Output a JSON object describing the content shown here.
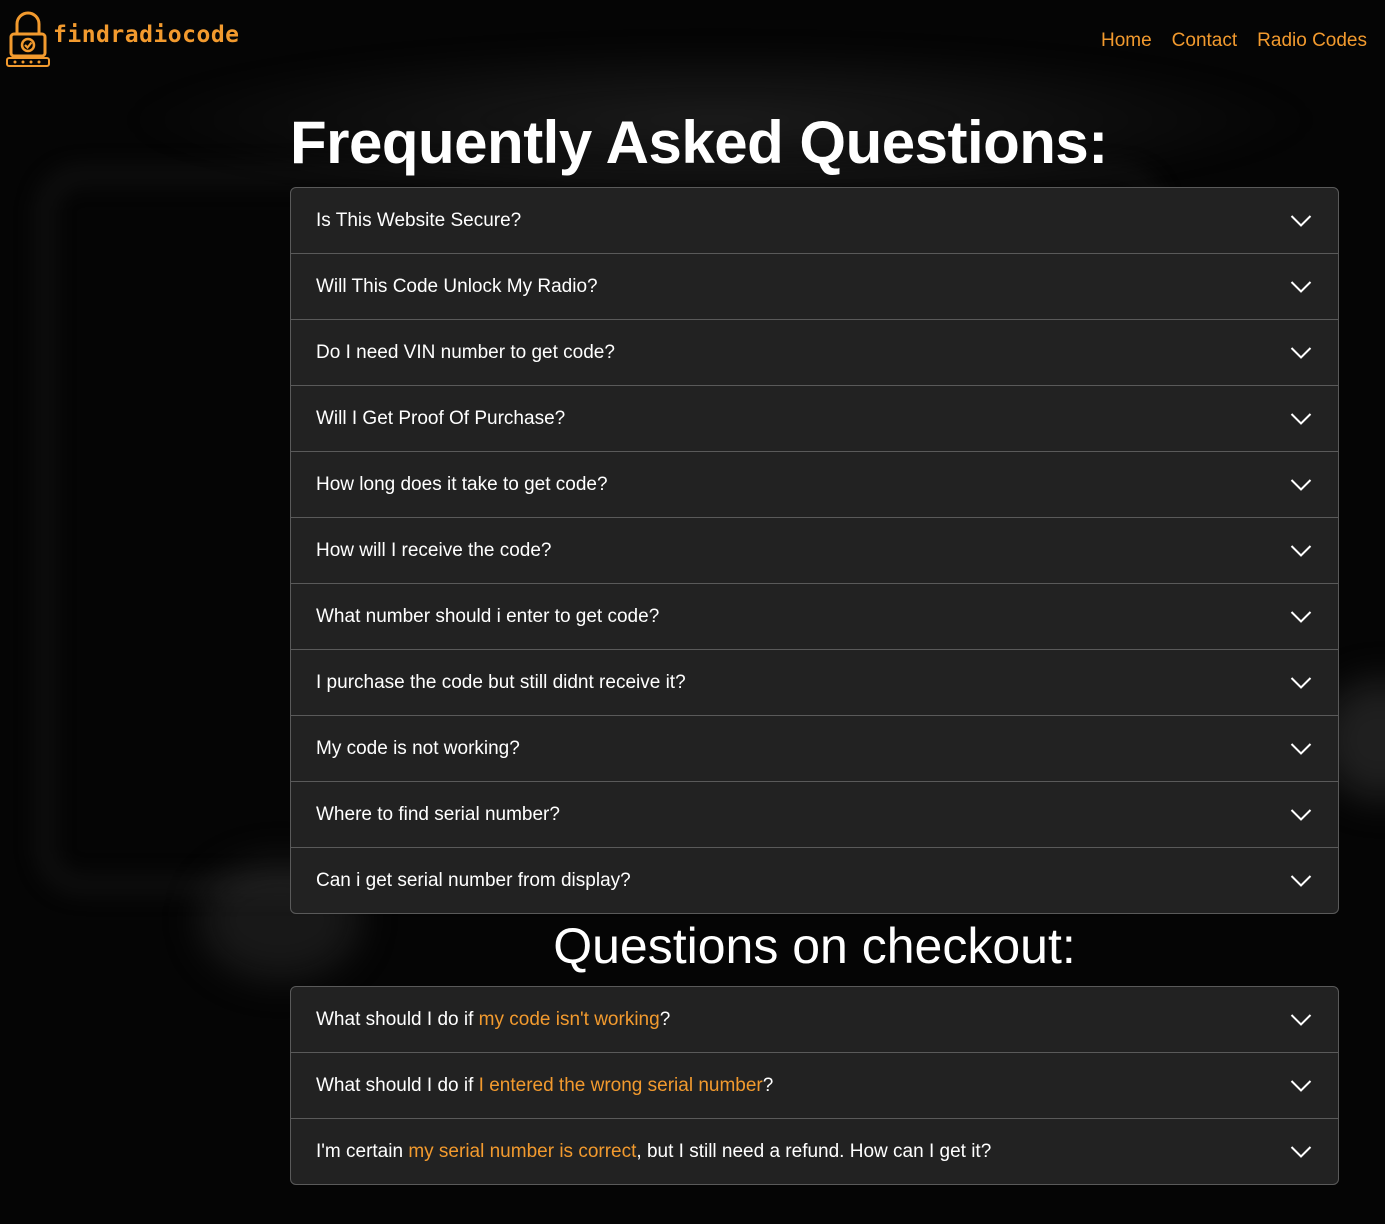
{
  "brand": {
    "name": "findradiocode",
    "logo_icon": "padlock-check-icon",
    "accent_color": "#f29a2e"
  },
  "nav": [
    {
      "label": "Home"
    },
    {
      "label": "Contact"
    },
    {
      "label": "Radio Codes"
    }
  ],
  "faq": {
    "title": "Frequently Asked Questions:",
    "items": [
      {
        "label": "Is This Website Secure?"
      },
      {
        "label": "Will This Code Unlock My Radio?"
      },
      {
        "label": "Do I need VIN number to get code?"
      },
      {
        "label": "Will I Get Proof Of Purchase?"
      },
      {
        "label": "How long does it take to get code?"
      },
      {
        "label": "How will I receive the code?"
      },
      {
        "label": "What number should i enter to get code?"
      },
      {
        "label": "I purchase the code but still didnt receive it?"
      },
      {
        "label": "My code is not working?"
      },
      {
        "label": "Where to find serial number?"
      },
      {
        "label": "Can i get serial number from display?"
      }
    ]
  },
  "checkout": {
    "title": "Questions on checkout:",
    "items": [
      {
        "pre": "What should I do if ",
        "highlight": "my code isn't working",
        "post": "?"
      },
      {
        "pre": "What should I do if ",
        "highlight": "I entered the wrong serial number",
        "post": "?"
      },
      {
        "pre": "I'm certain ",
        "highlight": "my serial number is correct",
        "post": ", but I still need a refund. How can I get it?"
      }
    ]
  }
}
